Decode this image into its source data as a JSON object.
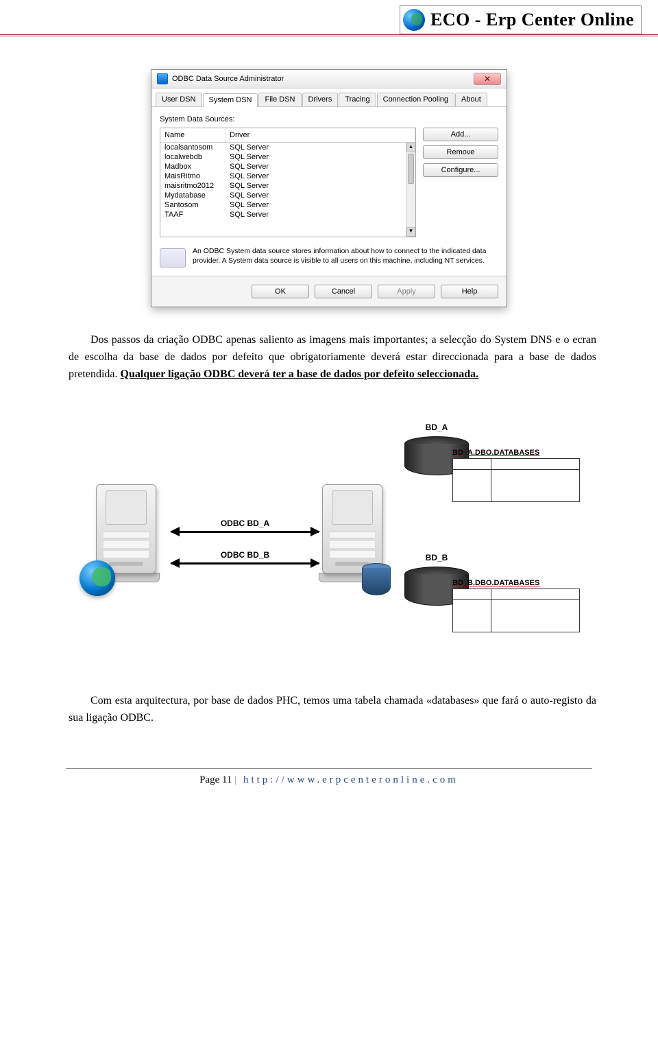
{
  "header": {
    "brand": "ECO - Erp Center Online"
  },
  "dialog": {
    "title": "ODBC Data Source Administrator",
    "tabs": [
      "User DSN",
      "System DSN",
      "File DSN",
      "Drivers",
      "Tracing",
      "Connection Pooling",
      "About"
    ],
    "active_tab": "System DSN",
    "pane_label": "System Data Sources:",
    "columns": {
      "name": "Name",
      "driver": "Driver"
    },
    "rows": [
      {
        "name": "localsantosom",
        "driver": "SQL Server"
      },
      {
        "name": "localwebdb",
        "driver": "SQL Server"
      },
      {
        "name": "Madbox",
        "driver": "SQL Server"
      },
      {
        "name": "MaisRitmo",
        "driver": "SQL Server"
      },
      {
        "name": "maisritmo2012",
        "driver": "SQL Server"
      },
      {
        "name": "Mydatabase",
        "driver": "SQL Server"
      },
      {
        "name": "Santosom",
        "driver": "SQL Server"
      },
      {
        "name": "TAAF",
        "driver": "SQL Server"
      }
    ],
    "buttons": {
      "add": "Add...",
      "remove": "Remove",
      "configure": "Configure..."
    },
    "info": "An ODBC System data source stores information about how to connect to the indicated data provider.  A System data source is visible to all users on this machine, including NT services.",
    "footer": {
      "ok": "OK",
      "cancel": "Cancel",
      "apply": "Apply",
      "help": "Help"
    }
  },
  "paragraph1_a": "Dos passos da criação ODBC apenas saliento as imagens mais importantes; a selecção do System DNS e o ecran de escolha da base de dados por defeito que obrigatoriamente deverá estar direccionada para a base de dados pretendida. ",
  "paragraph1_b": "Qualquer ligação ODBC deverá ter a base de dados por defeito seleccionada.",
  "diagram": {
    "odbc_a": "ODBC BD_A",
    "odbc_b": "ODBC BD_B",
    "bd_a": "BD_A",
    "bd_b": "BD_B",
    "table_a": "BD_A.DBO.DATABASES",
    "table_b": "BD_B.DBO.DATABASES"
  },
  "paragraph2": "Com esta arquitectura, por base de dados PHC, temos uma tabela chamada «databases» que fará o auto-registo da sua ligação ODBC.",
  "footer": {
    "page_label": "Page 11",
    "sep": " | ",
    "url": "http://www.erpcenteronline.com"
  }
}
